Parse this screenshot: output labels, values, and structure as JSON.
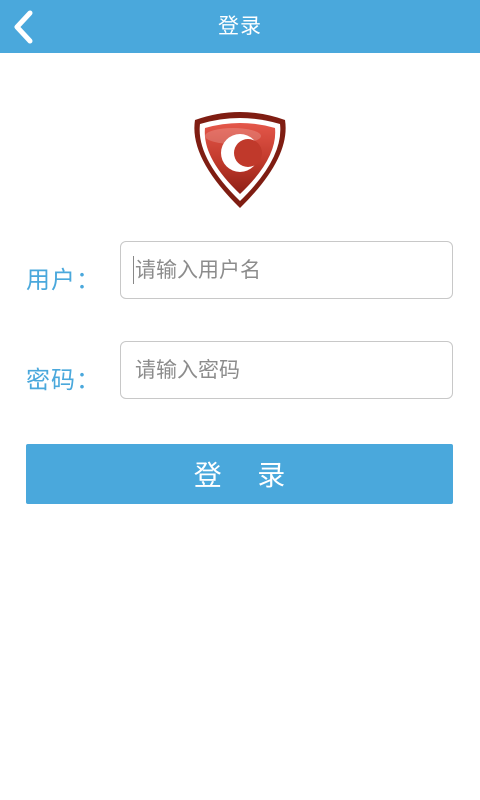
{
  "header": {
    "title": "登录",
    "back_icon": "chevron-left-icon"
  },
  "logo": {
    "icon": "shield-logo-icon",
    "colors": {
      "shield": "#c0392b",
      "ring": "#7f1d12"
    }
  },
  "form": {
    "username": {
      "label": "用户：",
      "placeholder": "请输入用户名",
      "value": ""
    },
    "password": {
      "label": "密码：",
      "placeholder": "请输入密码",
      "value": ""
    },
    "submit_label": "登    录"
  },
  "colors": {
    "accent": "#4aa8dc",
    "background": "#ffffff",
    "input_border": "#c8c8c8"
  }
}
